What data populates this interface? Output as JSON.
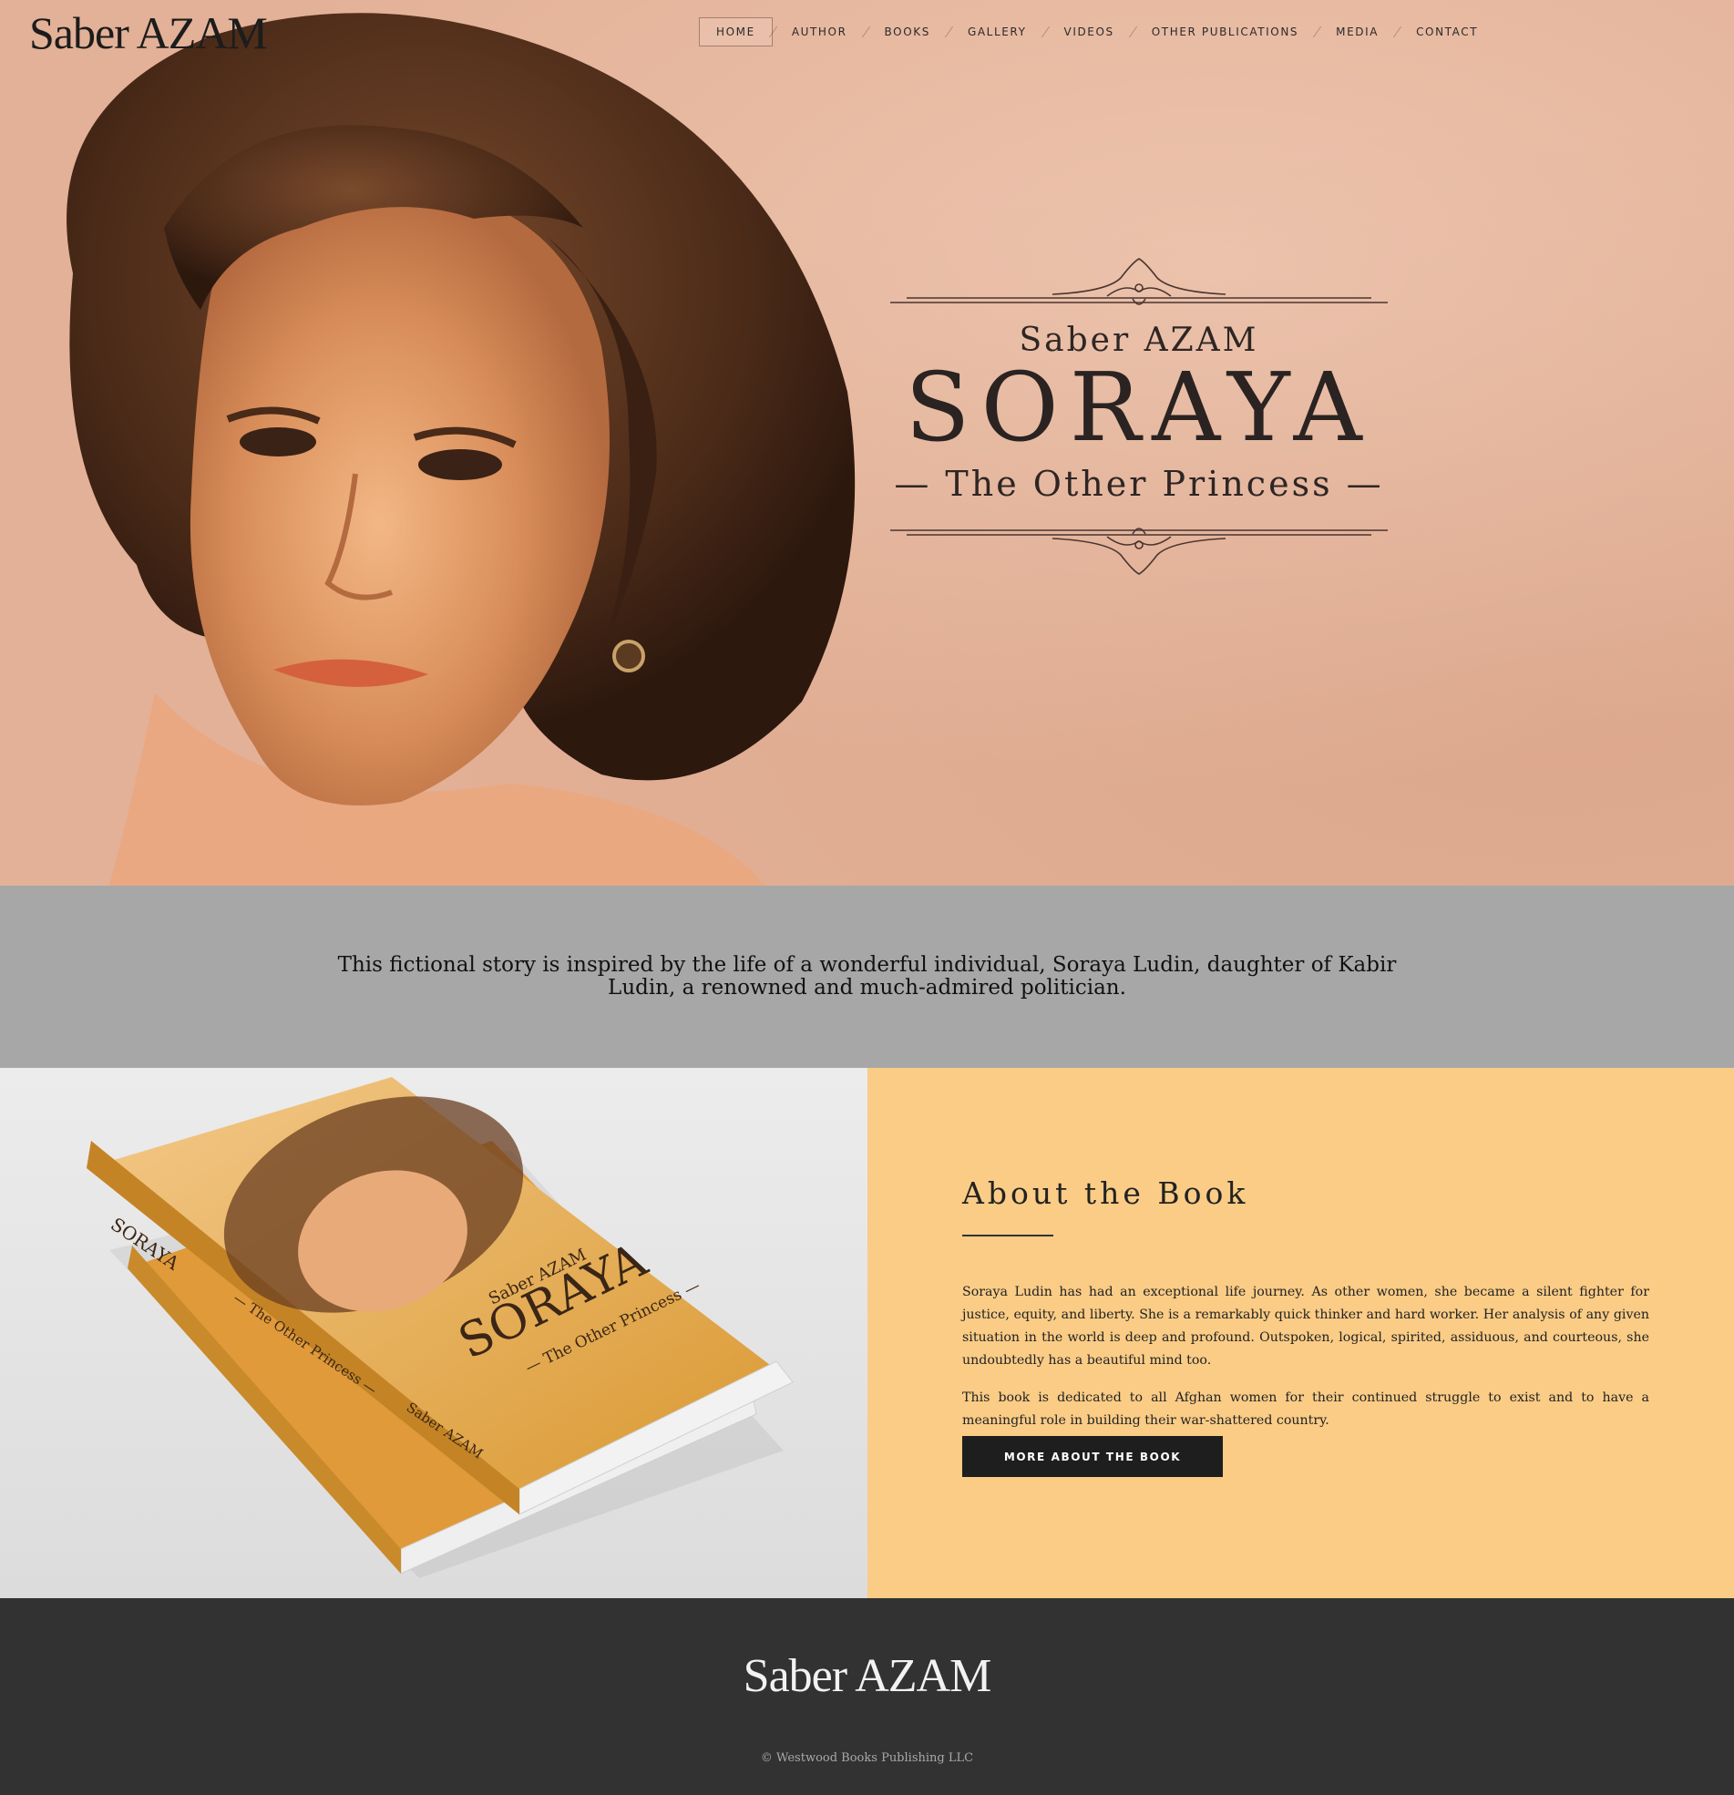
{
  "site": {
    "logo": "Saber AZAM"
  },
  "nav": {
    "items": [
      {
        "label": "HOME",
        "active": true
      },
      {
        "label": "AUTHOR"
      },
      {
        "label": "BOOKS"
      },
      {
        "label": "GALLERY"
      },
      {
        "label": "VIDEOS"
      },
      {
        "label": "OTHER PUBLICATIONS"
      },
      {
        "label": "MEDIA"
      },
      {
        "label": "CONTACT"
      }
    ]
  },
  "hero": {
    "author": "Saber AZAM",
    "title": "SORAYA",
    "subtitle": "— The Other Princess —",
    "background_color": "#e3b197"
  },
  "intro": {
    "text": "This fictional story is inspired by the life of a wonderful individual, Soraya Ludin, daughter of Kabir Ludin, a renowned and much-admired politician.",
    "background_color": "#a7a7a7"
  },
  "book_mockup": {
    "spine_title": "SORAYA",
    "spine_subtitle": "— The Other Princess —",
    "spine_author": "Saber AZAM",
    "cover_author": "Saber AZAM",
    "cover_title": "SORAYA",
    "cover_subtitle": "— The Other Princess —"
  },
  "about": {
    "heading": "About the Book",
    "paragraphs": [
      "Soraya Ludin has had an exceptional life journey. As other women, she became a silent fighter for justice, equity, and liberty. She is a remarkably quick thinker and hard worker. Her analysis of any given situation in the world is deep and profound. Outspoken, logical, spirited, assiduous, and courteous, she undoubtedly has a beautiful mind too.",
      "This book is dedicated to all Afghan women for their continued struggle to exist and to have a meaningful role in building their war-shattered country."
    ],
    "button_label": "MORE ABOUT THE BOOK",
    "background_color": "#facc86"
  },
  "footer": {
    "logo": "Saber AZAM",
    "copyright": "© Westwood Books Publishing LLC",
    "background_color": "#323232"
  }
}
